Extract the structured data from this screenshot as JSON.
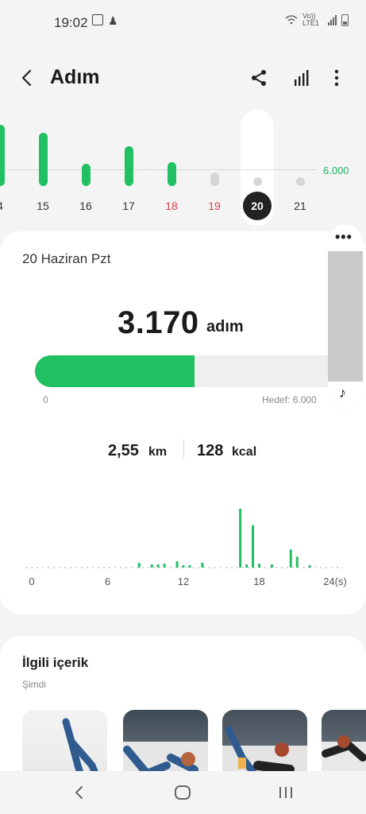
{
  "status": {
    "time": "19:02",
    "carrier": "Vo)) LTE1"
  },
  "header": {
    "title": "Adım"
  },
  "week": {
    "goal_label": "6.000",
    "days": [
      {
        "label": "4",
        "steps": 6000,
        "weekend": false,
        "selected": false,
        "empty": false
      },
      {
        "label": "15",
        "steps": 5200,
        "weekend": false,
        "selected": false,
        "empty": false
      },
      {
        "label": "16",
        "steps": 2200,
        "weekend": false,
        "selected": false,
        "empty": false
      },
      {
        "label": "17",
        "steps": 3900,
        "weekend": false,
        "selected": false,
        "empty": false
      },
      {
        "label": "18",
        "steps": 2300,
        "weekend": true,
        "selected": false,
        "empty": false
      },
      {
        "label": "19",
        "steps": 0,
        "weekend": true,
        "selected": false,
        "empty": true
      },
      {
        "label": "20",
        "steps": 0,
        "weekend": false,
        "selected": true,
        "empty": true
      },
      {
        "label": "21",
        "steps": 0,
        "weekend": false,
        "selected": false,
        "empty": true
      }
    ]
  },
  "summary": {
    "date": "20 Haziran Pzt",
    "steps": "3.170",
    "steps_unit": "adım",
    "progress_fraction": 0.528,
    "progress_start": "0",
    "target_label": "Hedef: 6.000",
    "distance": "2,55",
    "distance_unit": "km",
    "calories": "128",
    "calories_unit": "kcal"
  },
  "chart_data": {
    "type": "bar",
    "x_ticks": [
      "0",
      "6",
      "12",
      "18",
      "24(s)"
    ],
    "xlim": [
      0,
      24
    ],
    "bars": [
      {
        "hour": 8.5,
        "value": 6
      },
      {
        "hour": 9.5,
        "value": 4
      },
      {
        "hour": 10.0,
        "value": 4
      },
      {
        "hour": 10.5,
        "value": 5
      },
      {
        "hour": 11.5,
        "value": 8
      },
      {
        "hour": 12.0,
        "value": 3
      },
      {
        "hour": 12.5,
        "value": 3
      },
      {
        "hour": 13.5,
        "value": 6
      },
      {
        "hour": 16.5,
        "value": 75
      },
      {
        "hour": 17.0,
        "value": 4
      },
      {
        "hour": 17.5,
        "value": 54
      },
      {
        "hour": 18.0,
        "value": 5
      },
      {
        "hour": 19.0,
        "value": 4
      },
      {
        "hour": 20.5,
        "value": 23
      },
      {
        "hour": 21.0,
        "value": 14
      },
      {
        "hour": 22.0,
        "value": 3
      }
    ]
  },
  "related": {
    "title": "İlgili içerik",
    "subtitle": "Şimdi"
  },
  "colors": {
    "accent": "#21c063",
    "weekend": "#d8434a"
  }
}
